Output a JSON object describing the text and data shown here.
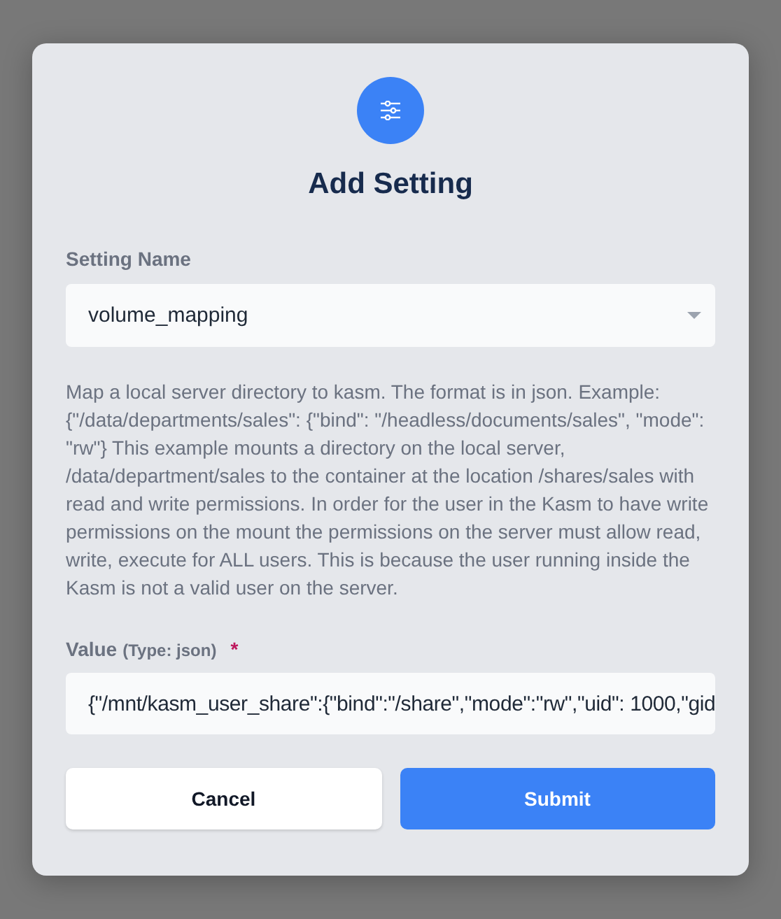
{
  "dialog": {
    "title": "Add Setting",
    "setting_name": {
      "label": "Setting Name",
      "value": "volume_mapping"
    },
    "description": "Map a local server directory to kasm. The format is in json. Example: {\"/data/departments/sales\": {\"bind\": \"/headless/documents/sales\", \"mode\": \"rw\"} This example mounts a directory on the local server, /data/department/sales to the container at the location /shares/sales with read and write permissions. In order for the user in the Kasm to have write permissions on the mount the permissions on the server must allow read, write, execute for ALL users. This is because the user running inside the Kasm is not a valid user on the server.",
    "value": {
      "label": "Value",
      "type_hint": "(Type: json)",
      "required": true,
      "required_mark": "*",
      "value": "{\"/mnt/kasm_user_share\":{\"bind\":\"/share\",\"mode\":\"rw\",\"uid\": 1000,\"gid"
    },
    "buttons": [
      {
        "label": "Cancel",
        "kind": "secondary"
      },
      {
        "label": "Submit",
        "kind": "primary"
      }
    ]
  }
}
